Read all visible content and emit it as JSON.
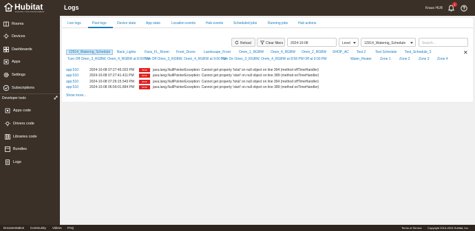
{
  "app": {
    "brand": "Hubitat",
    "tagline": "ELEVATE YOUR ENVIRONMENT",
    "page_title": "Logs",
    "hub_name": "Kraus HUB",
    "notification_count": "1"
  },
  "sidebar": {
    "items": [
      {
        "label": "Rooms",
        "icon": "rooms-icon"
      },
      {
        "label": "Devices",
        "icon": "devices-icon"
      },
      {
        "label": "Dashboards",
        "icon": "dashboards-icon"
      },
      {
        "label": "Apps",
        "icon": "apps-icon"
      },
      {
        "label": "Settings",
        "icon": "gear-icon"
      },
      {
        "label": "Subscriptions",
        "icon": "subscriptions-icon"
      }
    ],
    "dev_tools_label": "Developer tools",
    "dev_items": [
      {
        "label": "Apps code",
        "icon": "apps-code-icon"
      },
      {
        "label": "Drivers code",
        "icon": "drivers-code-icon"
      },
      {
        "label": "Libraries code",
        "icon": "libraries-code-icon"
      },
      {
        "label": "Bundles",
        "icon": "bundles-icon"
      },
      {
        "label": "Logs",
        "icon": "logs-icon"
      }
    ]
  },
  "tabs": [
    "Live logs",
    "Past logs",
    "Device stats",
    "App stats",
    "Location events",
    "Hub events",
    "Scheduled jobs",
    "Running jobs",
    "Hub actions"
  ],
  "active_tab": "Past logs",
  "toolbar": {
    "reload_label": "Reload",
    "clear_filters_label": "Clear filters",
    "date_value": "2024-10-08",
    "level_value": "Level",
    "app_value": "12914_Watering_Schedule",
    "search_placeholder": "Search..."
  },
  "filter_chips": {
    "row1": [
      "12914_Watering_Schedule",
      "Back_Lights",
      "Fans_FL_Room",
      "Front_Doors",
      "Landscape_Front",
      "Orein_1_RGBW",
      "Orein_4_RGBW",
      "Orein_2_RGBW",
      "SHOP_AC",
      "Test 2",
      "Test Schedule",
      "Test_Schedule_3"
    ],
    "row2": [
      "Turn Off Orien_3_RGBW, Orein_4_RGBW at 8:59 PM",
      "Turn Off Orien_3_RGBW, Orein_4_RGBW at 9:00 PM",
      "Turn On Orien_3_RGBW, Orein_4_RGBW at 8:58 PM Off at 9:00 PM",
      "Water_Heater",
      "Zone 1",
      "Zone 2",
      "Zone 3",
      "Zone 4"
    ]
  },
  "logs": [
    {
      "source": "app:510",
      "timestamp": "2024-10-08 07:27:45.023 PM",
      "level": "error",
      "message": "java.lang.NullPointerException: Cannot get property 'total' on null object on line 394 (method offTimeHandler)"
    },
    {
      "source": "app:510",
      "timestamp": "2024-10-08 07:27:41.411 PM",
      "level": "error",
      "message": "java.lang.NullPointerException: Cannot get property 'start' on null object on line 389 (method onTimeHandler)"
    },
    {
      "source": "app:510",
      "timestamp": "2024-10-08 07:26:15.543 PM",
      "level": "error",
      "message": "java.lang.NullPointerException: Cannot get property 'total' on null object on line 394 (method offTimeHandler)"
    },
    {
      "source": "app:510",
      "timestamp": "2024-10-08 06:59:01.894 PM",
      "level": "error",
      "message": "java.lang.NullPointerException: Cannot get property 'start' on null object on line 389 (method onTimeHandler)"
    }
  ],
  "show_more_label": "Show more...",
  "footer": {
    "links": [
      "Documentation",
      "Community",
      "Videos",
      "FAQ"
    ],
    "terms": "Terms of Service",
    "copyright": "Copyright 2016-2024 Hubitat, Inc."
  },
  "colors": {
    "sidebar_bg": "#3b3027",
    "accent": "#1a7dbf",
    "error_badge": "#e02020"
  }
}
